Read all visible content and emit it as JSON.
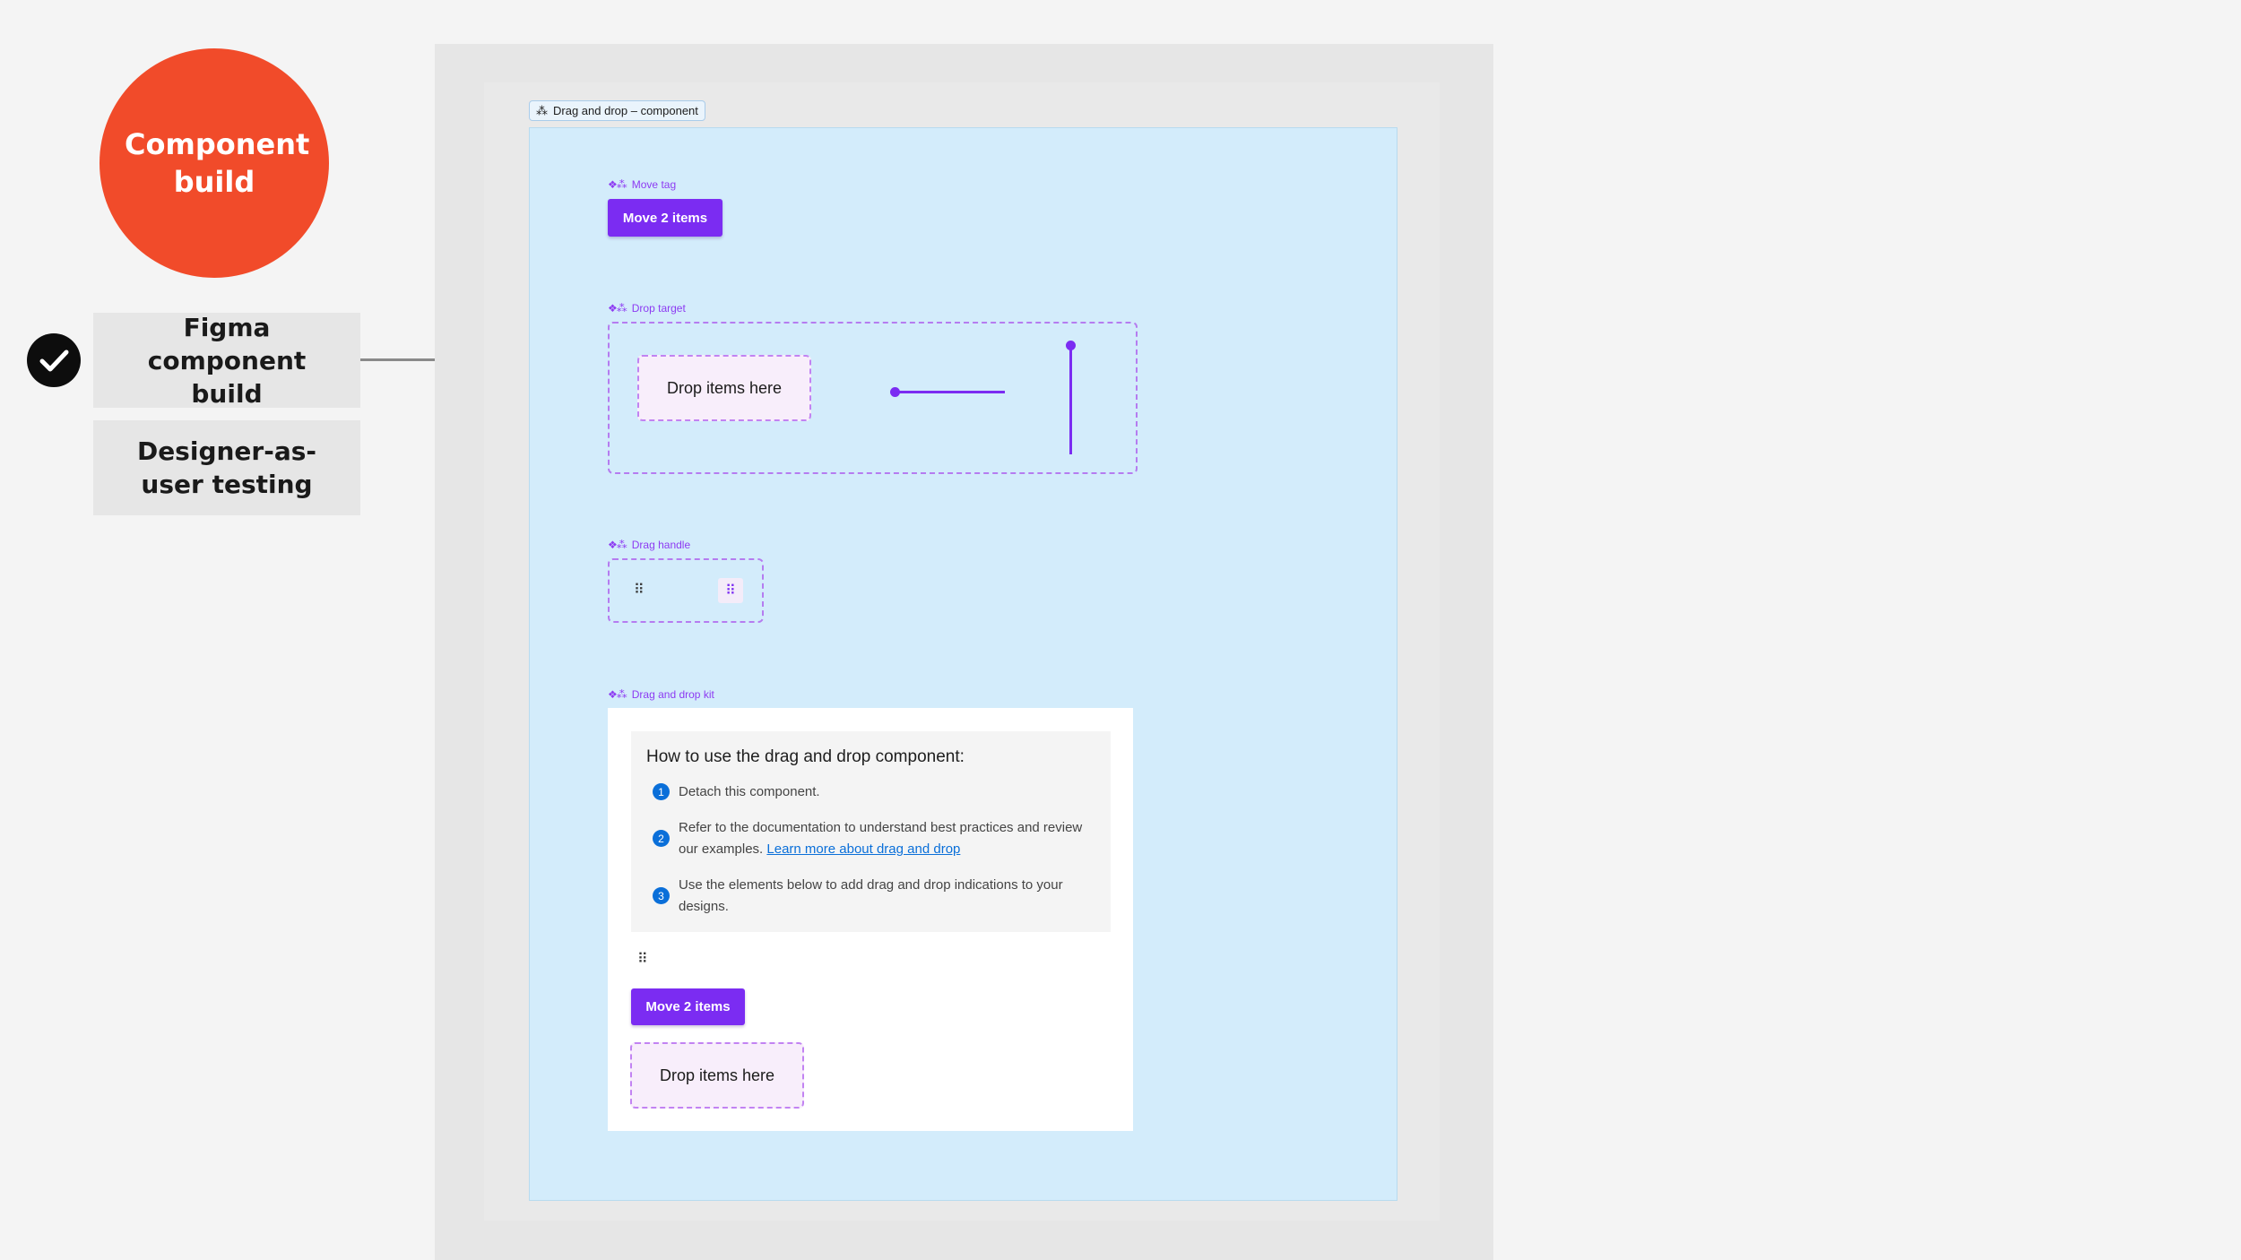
{
  "process": {
    "phase_title": "Component build",
    "steps": [
      {
        "label": "Figma component build",
        "completed": true
      },
      {
        "label": "Designer-as-user testing",
        "completed": false
      }
    ]
  },
  "figma": {
    "frame_label": "Drag and drop – component",
    "move_tag": {
      "label": "Move tag",
      "button_text": "Move 2 items"
    },
    "drop_target": {
      "label": "Drop target",
      "drop_text": "Drop items here"
    },
    "drag_handle": {
      "label": "Drag handle",
      "grip_glyph": "⠿"
    },
    "kit": {
      "label": "Drag and drop kit",
      "title": "How to use the drag and drop component:",
      "steps": [
        {
          "num": "1",
          "text": "Detach this component."
        },
        {
          "num": "2",
          "text": "Refer to the documentation to understand best practices and review our examples.",
          "link": "Learn more about drag and drop"
        },
        {
          "num": "3",
          "text": "Use the elements below to add drag and drop indications to your designs."
        }
      ],
      "button_text": "Move 2 items",
      "drop_text": "Drop items here"
    }
  },
  "colors": {
    "phase": "#f14b2a",
    "accent": "#7b2cf2",
    "frame_bg": "#d3ecfb",
    "link": "#0a6fd9"
  },
  "icons": {
    "component_glyph": "component-icon",
    "check": "check-circle-icon",
    "grip": "drag-grip-icon"
  }
}
